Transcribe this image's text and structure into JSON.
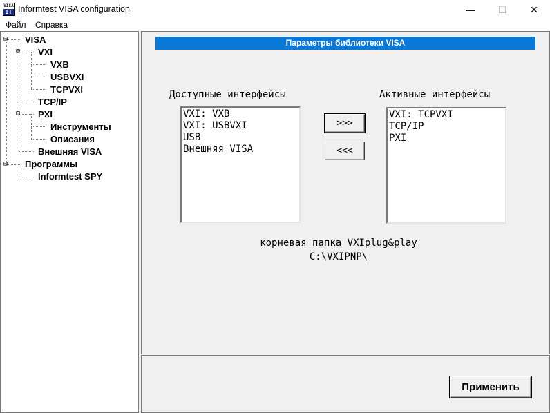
{
  "window": {
    "title": "Informtest VISA configuration",
    "icon_top": "VISA",
    "icon_bottom": "IT",
    "minimize_glyph": "—",
    "maximize_glyph": "☐",
    "close_glyph": "✕"
  },
  "menu": [
    "Файл",
    "Справка"
  ],
  "tree": {
    "visa": "VISA",
    "vxi": "VXI",
    "vxb": "VXB",
    "usbvxi": "USBVXI",
    "tcpvxi": "TCPVXI",
    "tcpip": "TCP/IP",
    "pxi": "PXI",
    "instruments": "Инструменты",
    "descriptions": "Описания",
    "external_visa": "Внешняя VISA",
    "programs": "Программы",
    "spy": "Informtest SPY"
  },
  "main": {
    "header": "Параметры библиотеки VISA",
    "available_label": "Доступные интерфейсы",
    "active_label": "Активные интерфейсы",
    "available_items": [
      "VXI: VXB",
      "VXI: USBVXI",
      "USB",
      "Внешняя VISA"
    ],
    "active_items": [
      "VXI: TCPVXI",
      "TCP/IP",
      "PXI"
    ],
    "add_button": ">>>",
    "remove_button": "<<<",
    "root_folder_label": "корневая папка VXIplug&play",
    "root_folder_path": "C:\\VXIPNP\\"
  },
  "footer": {
    "apply_button": "Применить"
  }
}
